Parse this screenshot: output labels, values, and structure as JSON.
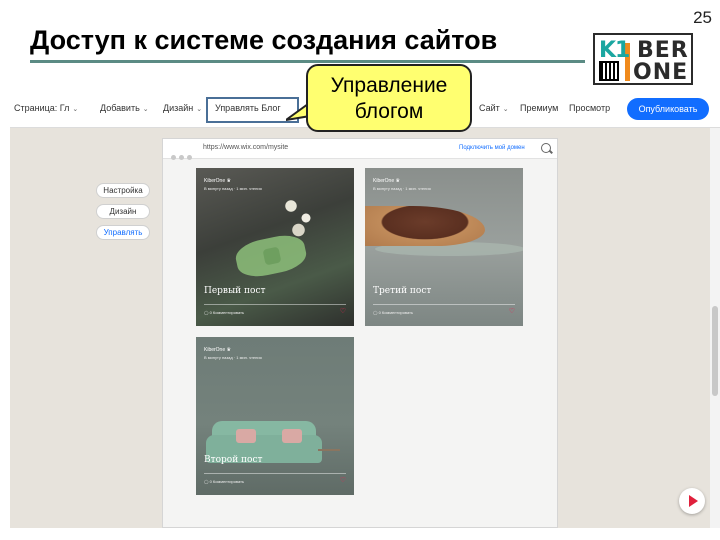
{
  "slide": {
    "title": "Доступ к системе создания сайтов",
    "number": "25"
  },
  "logo": {
    "text_top_k1": "K1",
    "text_top_ber": "BER",
    "text_bottom": "ONE"
  },
  "callout": {
    "text_line1": "Управление",
    "text_line2": "блогом"
  },
  "toolbar": {
    "page_label": "Страница: Гл",
    "add_label": "Добавить",
    "design_label": "Дизайн",
    "manage_blog_label": "Управлять Блог",
    "site_label": "Сайт",
    "premium_label": "Премиум",
    "preview_label": "Просмотр",
    "publish_label": "Опубликовать"
  },
  "side_menu": {
    "items": [
      {
        "label": "Настройка"
      },
      {
        "label": "Дизайн"
      },
      {
        "label": "Управлять"
      }
    ]
  },
  "browser": {
    "url": "https://www.wix.com/mysite",
    "connect_domain": "Подключить мой домен"
  },
  "posts": [
    {
      "author": "KiberOne ♛",
      "time": "В минуту назад · 1 мин. чтения",
      "title": "Первый пост",
      "stats": "◯ 0   Комментировать"
    },
    {
      "author": "KiberOne ♛",
      "time": "В минуту назад · 1 мин. чтения",
      "title": "Третий пост",
      "stats": "◯ 0   Комментировать"
    },
    {
      "author": "KiberOne ♛",
      "time": "В минуту назад · 1 мин. чтения",
      "title": "Второй пост",
      "stats": "◯ 0   Комментировать"
    }
  ],
  "colors": {
    "accent": "#116dff",
    "callout_fill": "#ffff70",
    "highlight_border": "#4a6f97",
    "title_rule": "#5b8b84"
  }
}
